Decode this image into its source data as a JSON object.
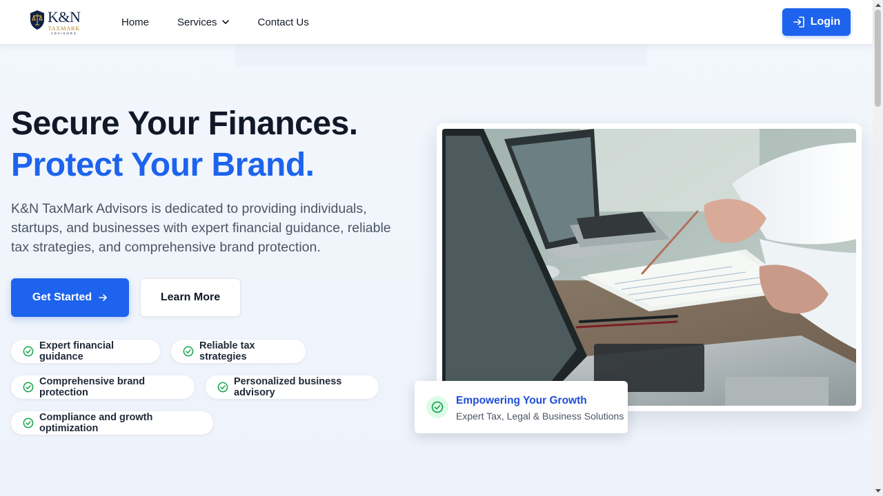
{
  "brand": {
    "name": "K&N",
    "sub1": "TAXMARK",
    "sub2": "ADVISORS"
  },
  "nav": {
    "home": "Home",
    "services": "Services",
    "contact": "Contact Us",
    "login": "Login"
  },
  "hero": {
    "headline_line1": "Secure Your Finances.",
    "headline_line2": "Protect Your Brand.",
    "description": "K&N TaxMark Advisors is dedicated to providing individuals, startups, and businesses with expert financial guidance, reliable tax strategies, and comprehensive brand protection.",
    "cta_primary": "Get Started",
    "cta_secondary": "Learn More"
  },
  "features": [
    "Expert financial guidance",
    "Reliable tax strategies",
    "Comprehensive brand protection",
    "Personalized business advisory",
    "Compliance and growth optimization"
  ],
  "badge": {
    "title": "Empowering Your Growth",
    "subtitle": "Expert Tax, Legal & Business Solutions"
  },
  "colors": {
    "primary": "#1d63ed",
    "check": "#16a34a",
    "heading": "#111827",
    "logo_gold": "#b7862e",
    "logo_navy": "#0f2347"
  },
  "icons": {
    "login": "login-icon",
    "arrow": "arrow-right-icon",
    "check": "check-circle-icon",
    "chevron": "chevron-down-icon",
    "logo": "scales-shield-icon"
  }
}
